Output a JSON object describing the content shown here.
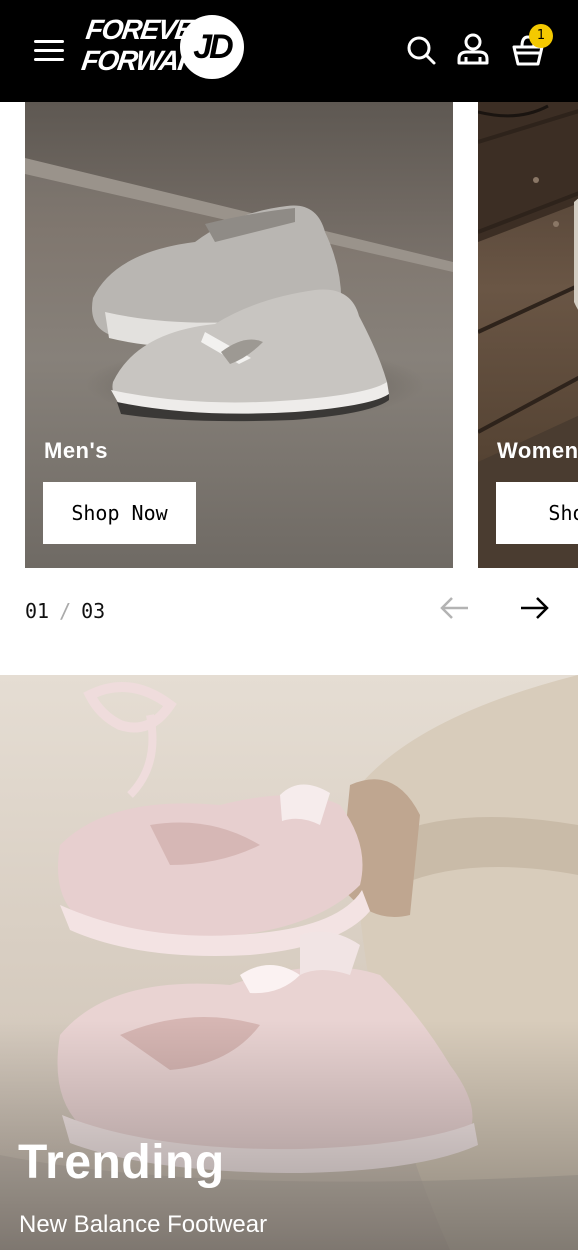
{
  "header": {
    "logo_text_line1": "FOREVER",
    "logo_text_line2": "FORWARD",
    "logo_badge": "JD",
    "icons": [
      "menu-icon",
      "search-icon",
      "account-icon",
      "basket-icon"
    ],
    "cart_count": "1",
    "cart_badge_color": "#f4c900",
    "background": "#000000"
  },
  "carousel": {
    "slides": [
      {
        "label": "Men's",
        "button": "Shop Now"
      },
      {
        "label": "Women",
        "button": "Shop"
      }
    ],
    "pager": {
      "current": "01",
      "separator": "/",
      "total": "03"
    },
    "icons": [
      "arrow-left-icon",
      "arrow-right-icon"
    ]
  },
  "trending": {
    "title": "Trending",
    "subtitle": "New Balance Footwear"
  }
}
